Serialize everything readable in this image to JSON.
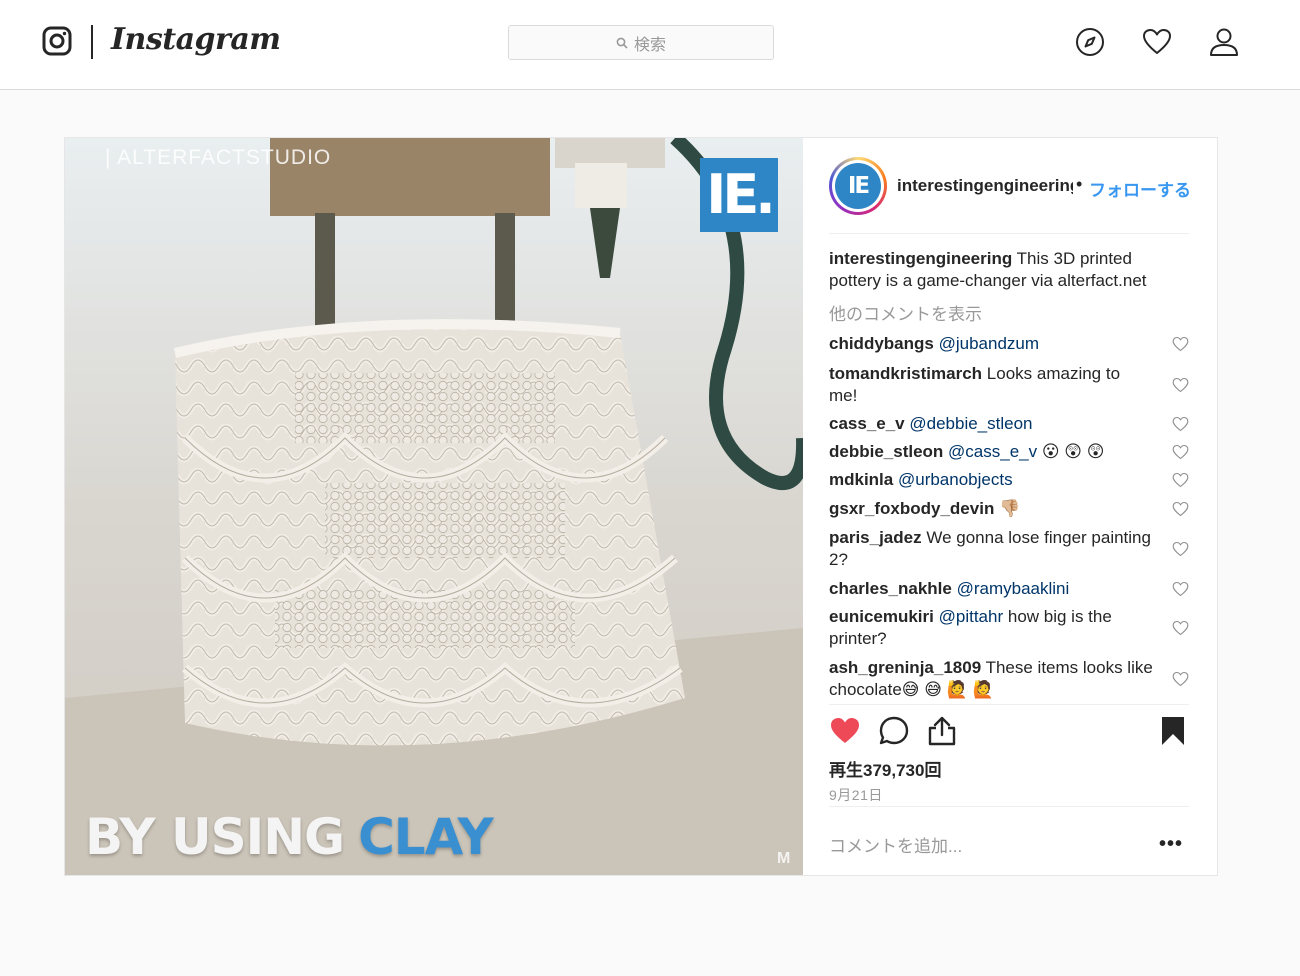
{
  "nav": {
    "wordmark": "Instagram",
    "search_placeholder": "検索",
    "icons": [
      "instagram-logo-icon",
      "compass-icon",
      "heart-icon",
      "user-icon"
    ]
  },
  "post": {
    "media": {
      "watermark": "| ALTERFACTSTUDIO",
      "brand_logo": "IE.",
      "overlay_text_white": "BY USING",
      "overlay_text_blue": "CLAY"
    },
    "header": {
      "avatar_text": "IE",
      "username": "interestingengineering",
      "separator": "•",
      "follow": "フォローする"
    },
    "caption": {
      "user": "interestingengineering",
      "text": "This 3D printed pottery is a game-changer via alterfact.net"
    },
    "load_more": "他のコメントを表示",
    "comments": [
      {
        "user": "chiddybangs",
        "mention": "@jubandzum",
        "text": ""
      },
      {
        "user": "tomandkristimarch",
        "mention": "",
        "text": "Looks amazing to me!"
      },
      {
        "user": "cass_e_v",
        "mention": "@debbie_stleon",
        "text": ""
      },
      {
        "user": "debbie_stleon",
        "mention": "@cass_e_v",
        "text": "😮 😲 😲"
      },
      {
        "user": "mdkinla",
        "mention": "@urbanobjects",
        "text": ""
      },
      {
        "user": "gsxr_foxbody_devin",
        "mention": "",
        "text": "👎🏼"
      },
      {
        "user": "paris_jadez",
        "mention": "",
        "text": "We gonna lose finger painting 2?"
      },
      {
        "user": "charles_nakhle",
        "mention": "@ramybaaklini",
        "text": ""
      },
      {
        "user": "eunicemukiri",
        "mention": "@pittahr",
        "text": "how big is the printer?"
      },
      {
        "user": "ash_greninja_1809",
        "mention": "",
        "text": "These items looks like chocolate😅 😅 🙋 🙋"
      }
    ],
    "views": "再生379,730回",
    "date": "9月21日",
    "add_comment_placeholder": "コメントを追加...",
    "more_options": "•••"
  },
  "colors": {
    "liked_heart": "#ed4956",
    "link_blue": "#3897f0",
    "mention": "#003569",
    "ie_blue": "#2f86c6"
  }
}
